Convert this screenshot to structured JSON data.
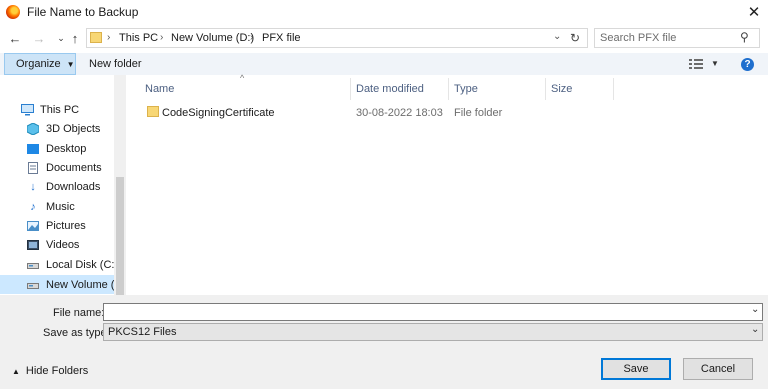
{
  "window": {
    "title": "File Name to Backup"
  },
  "address": {
    "crumbs": [
      "This PC",
      "New Volume (D:)",
      "PFX file"
    ],
    "search_placeholder": "Search PFX file"
  },
  "toolbar": {
    "organize_label": "Organize",
    "new_folder_label": "New folder",
    "help_label": "?"
  },
  "nav": {
    "items": [
      {
        "label": "This PC",
        "icon": "monitor-icon"
      },
      {
        "label": "3D Objects",
        "icon": "cube-icon"
      },
      {
        "label": "Desktop",
        "icon": "desktop-icon"
      },
      {
        "label": "Documents",
        "icon": "document-icon"
      },
      {
        "label": "Downloads",
        "icon": "download-icon"
      },
      {
        "label": "Music",
        "icon": "music-icon"
      },
      {
        "label": "Pictures",
        "icon": "picture-icon"
      },
      {
        "label": "Videos",
        "icon": "video-icon"
      },
      {
        "label": "Local Disk (C:)",
        "icon": "drive-icon"
      },
      {
        "label": "New Volume (D:",
        "icon": "drive-icon"
      }
    ]
  },
  "files": {
    "columns": [
      "Name",
      "Date modified",
      "Type",
      "Size"
    ],
    "rows": [
      {
        "name": "CodeSigningCertificate",
        "date": "30-08-2022 18:03",
        "type": "File folder",
        "size": ""
      }
    ]
  },
  "form": {
    "file_name_label": "File name:",
    "file_name_value": "",
    "save_type_label": "Save as type:",
    "save_type_value": "PKCS12 Files"
  },
  "buttons": {
    "save": "Save",
    "cancel": "Cancel",
    "hide_folders": "Hide Folders"
  },
  "colors": {
    "accent": "#0078d7",
    "folder": "#f8d775",
    "selected_nav": "#cce8ff"
  }
}
